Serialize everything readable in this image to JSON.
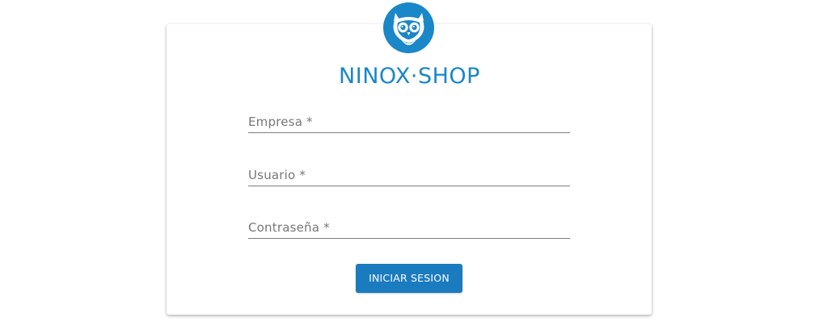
{
  "brand": {
    "name": "NINOX·SHOP",
    "logo_icon": "owl-icon",
    "color": "#1a87c8"
  },
  "form": {
    "fields": [
      {
        "label": "Empresa *",
        "type": "text"
      },
      {
        "label": "Usuario *",
        "type": "text"
      },
      {
        "label": "Contraseña *",
        "type": "password"
      }
    ],
    "submit_label": "INICIAR SESION",
    "button_color": "#1a7bbf"
  }
}
